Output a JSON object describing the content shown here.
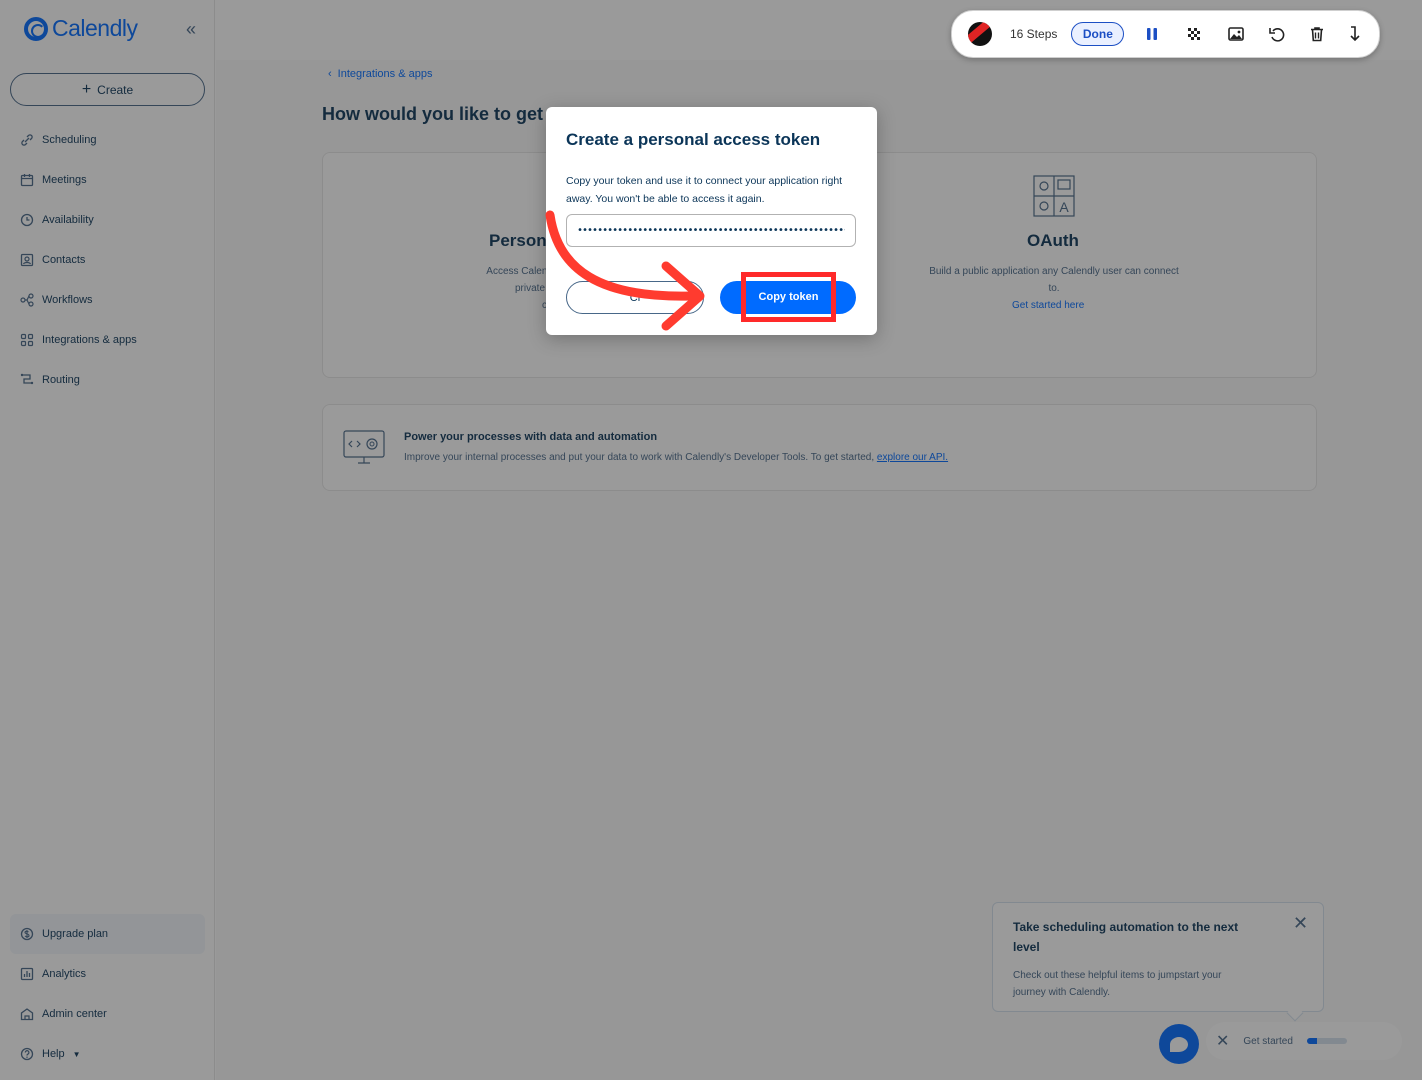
{
  "app": {
    "logo_text": "Calendly",
    "collapse_label": "«"
  },
  "sidebar": {
    "create_label": "Create",
    "items": [
      {
        "label": "Scheduling",
        "icon": "link-icon"
      },
      {
        "label": "Meetings",
        "icon": "calendar-icon"
      },
      {
        "label": "Availability",
        "icon": "clock-icon"
      },
      {
        "label": "Contacts",
        "icon": "contacts-icon"
      },
      {
        "label": "Workflows",
        "icon": "workflows-icon"
      },
      {
        "label": "Integrations & apps",
        "icon": "grid-icon"
      },
      {
        "label": "Routing",
        "icon": "routing-icon"
      }
    ],
    "bottom_items": [
      {
        "label": "Upgrade plan",
        "icon": "dollar-icon"
      },
      {
        "label": "Analytics",
        "icon": "analytics-icon"
      },
      {
        "label": "Admin center",
        "icon": "admin-icon"
      },
      {
        "label": "Help",
        "icon": "help-icon"
      }
    ]
  },
  "main": {
    "breadcrumb": "Integrations & apps",
    "page_title": "How would you like to get s",
    "options": {
      "personal_title": "Person",
      "personal_desc_1": "Access Calend",
      "personal_desc_2": "private",
      "personal_desc_3": "c",
      "oauth_title": "OAuth",
      "oauth_desc": "Build a public application any Calendly user can connect to.",
      "oauth_link": "Get started here"
    },
    "dev": {
      "title": "Power your processes with data and automation",
      "desc": "Improve your internal processes and put your data to work with Calendly's Developer Tools. To get started,",
      "link": "explore our API."
    }
  },
  "modal": {
    "title": "Create a personal access token",
    "desc": "Copy your token and use it to connect your application right away. You won't be able to access it again.",
    "token_value": "••••••••••••••••••••••••••••••••••••••••••••••••••••••••••••••••",
    "close_label": "Cl",
    "copy_label": "Copy token"
  },
  "recorder": {
    "steps": "16 Steps",
    "done_label": "Done"
  },
  "promo": {
    "title": "Take scheduling automation to the next level",
    "desc": "Check out these helpful items to jumpstart your journey with Calendly.",
    "get_started": "Get started",
    "progress": 0.25
  },
  "colors": {
    "brand": "#006bff",
    "highlight": "#ff2a2a",
    "text": "#0b3558"
  }
}
